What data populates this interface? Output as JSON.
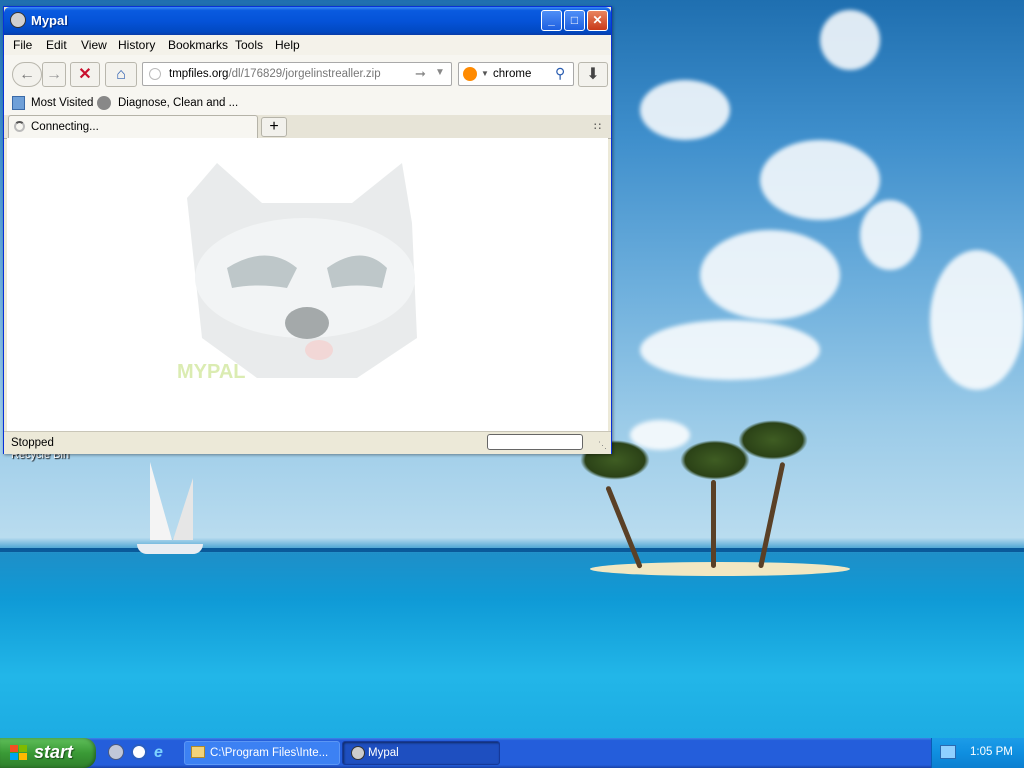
{
  "window": {
    "title": "Mypal",
    "controls": {
      "minimize": "_",
      "maximize": "□",
      "close": "✕"
    }
  },
  "menu": [
    "File",
    "Edit",
    "View",
    "History",
    "Bookmarks",
    "Tools",
    "Help"
  ],
  "nav": {
    "url_host": "tmpfiles.org",
    "url_path": "/dl/176829/jorgelinstrealler.zip",
    "search_value": "chrome"
  },
  "bookmarks": [
    "Most Visited",
    "Diagnose, Clean and ..."
  ],
  "tabs": [
    {
      "label": "Connecting..."
    }
  ],
  "content": {
    "logo_caption": "MYPAL"
  },
  "status": {
    "text": "Stopped"
  },
  "desktop": {
    "recycle_bin_label": "Recycle Bin"
  },
  "taskbar": {
    "start_label": "start",
    "tasks": [
      {
        "label": "C:\\Program Files\\Inte..."
      },
      {
        "label": "Mypal"
      }
    ],
    "clock": "1:05 PM"
  },
  "colors": {
    "title_bar": "#0553d8",
    "taskbar": "#245edb",
    "start_button": "#3a9a36",
    "close_button": "#c8391a"
  }
}
